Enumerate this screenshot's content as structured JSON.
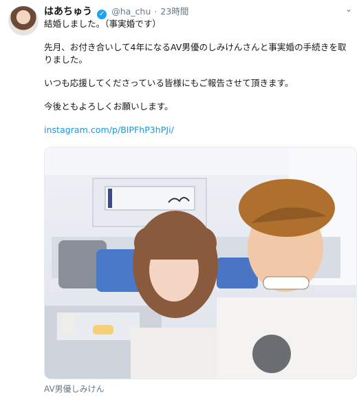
{
  "tweet": {
    "display_name": "はあちゅう",
    "handle": "@ha_chu",
    "separator": "·",
    "time": "23時間",
    "text_lines": [
      "結婚しました。（事実婚です）",
      "先月、お付き合いして4年になるAV男優のしみけんさんと事実婚の手続きを取りました。",
      "いつも応援してくださっている皆様にもご報告させて頂きます。",
      "今後ともよろしくお願いします。"
    ],
    "link_text": "instagram.com/p/BlPFhP3hPJi/",
    "media_caption": "AV男優しみけん"
  },
  "icons": {
    "verified": "verified-badge-icon",
    "more": "chevron-down-icon"
  },
  "colors": {
    "link": "#1b95e0",
    "verified": "#1da1f2",
    "muted": "#657786"
  }
}
